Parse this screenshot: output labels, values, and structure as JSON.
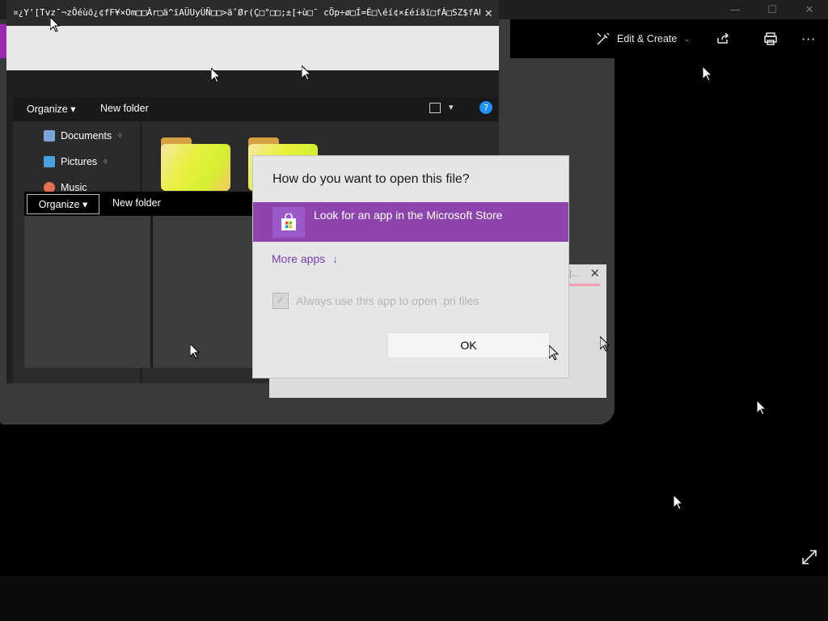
{
  "photos": {
    "edit_create_label": "Edit & Create",
    "chevron": "⌄",
    "more_label": "···",
    "minimize": "—",
    "maximize": "☐",
    "close": "✕"
  },
  "explorer": {
    "title": "¤¿Y'[Tvz¯¬zÔéùõ¿¢fF¥×Om□□Àr□ä^ïAÜUyÙÑ□□>äˆØr(Ç□°□□;±[+ù□¯ cÕp÷ø□Í=É□\\éí¢×£éíäï□fÁ□SZ$fAÜ...",
    "close": "✕",
    "organize_label": "Organize",
    "new_folder_label": "New folder",
    "nav_items": [
      {
        "label": "Documents",
        "pinned": "✧"
      },
      {
        "label": "Pictures",
        "pinned": "✧"
      },
      {
        "label": "Music",
        "pinned": ""
      }
    ]
  },
  "explorer2": {
    "organize_label": "Organize ▾",
    "new_folder_label": "New folder"
  },
  "bg_dialog": {
    "ellipsis": "J...",
    "close": "✕"
  },
  "dialog": {
    "title": "How do you want to open this file?",
    "store_label": "Look for an app in the Microsoft Store",
    "more_apps_label": "More apps",
    "more_apps_arrow": "↓",
    "always_label": "Always use this app to open .pri files",
    "ok_label": "OK",
    "accent_color": "#8e44ad",
    "link_color": "#7b3fb0"
  }
}
